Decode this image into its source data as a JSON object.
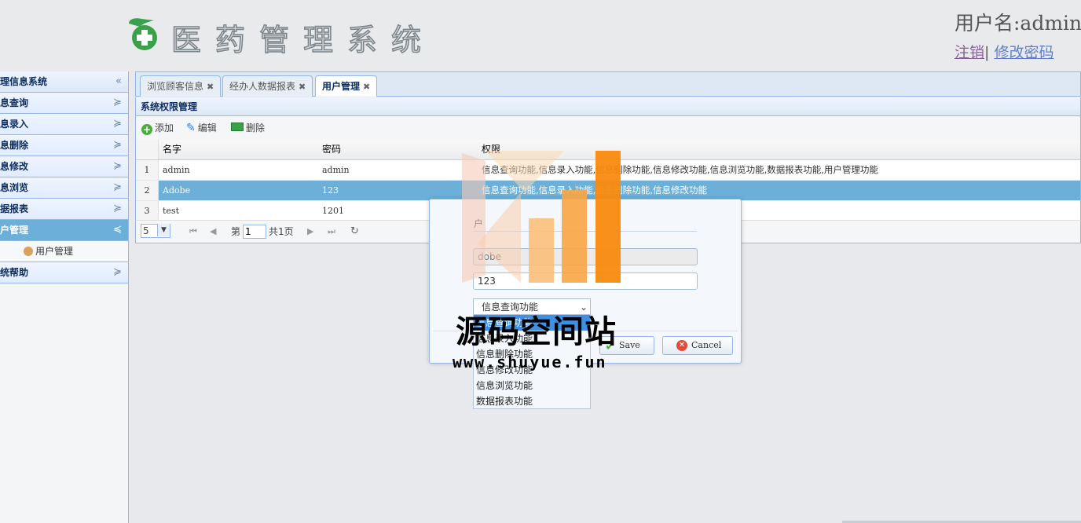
{
  "app": {
    "title": "医药管理系统",
    "user_label": "用户名:admin",
    "logout_link": "注销",
    "separator": "|",
    "change_password_link": "修改密码"
  },
  "sidebar": {
    "title": "管理信息系统",
    "collapse_glyph": "«",
    "items": [
      {
        "label": "信息查询"
      },
      {
        "label": "信息录入"
      },
      {
        "label": "信息删除"
      },
      {
        "label": "信息修改"
      },
      {
        "label": "信息浏览"
      },
      {
        "label": "数据报表"
      },
      {
        "label": "用户管理",
        "active": true
      },
      {
        "label": "系统帮助"
      }
    ],
    "sub_item": "用户管理"
  },
  "tabs": [
    {
      "label": "浏览顾客信息",
      "active": false
    },
    {
      "label": "经办人数据报表",
      "active": false
    },
    {
      "label": "用户管理",
      "active": true
    }
  ],
  "panel": {
    "title": "系统权限管理"
  },
  "toolbar": {
    "add_label": "添加",
    "edit_label": "编辑",
    "delete_label": "删除"
  },
  "grid": {
    "columns": [
      "名字",
      "密码",
      "权限"
    ],
    "rows": [
      {
        "num": "1",
        "name": "admin",
        "password": "admin",
        "permissions": "信息查询功能,信息录入功能,信息删除功能,信息修改功能,信息浏览功能,数据报表功能,用户管理功能"
      },
      {
        "num": "2",
        "name": "Adobe",
        "password": "123",
        "permissions": "信息查询功能,信息录入功能,信息删除功能,信息修改功能",
        "selected": true
      },
      {
        "num": "3",
        "name": "test",
        "password": "1201",
        "permissions": ""
      }
    ]
  },
  "pager": {
    "page_size": "5",
    "page_prefix": "第",
    "page_value": "1",
    "total_label": "共1页"
  },
  "dialog": {
    "heading": "户",
    "name_value": "dobe",
    "password_value": "123",
    "permission_selected": "信息查询功能",
    "save_label": "Save",
    "cancel_label": "Cancel"
  },
  "dropdown": {
    "options": [
      "信息查询功能",
      "信息录入功能",
      "信息删除功能",
      "信息修改功能",
      "信息浏览功能",
      "数据报表功能"
    ]
  },
  "watermark": {
    "text": "源码空间站",
    "url": "www.shuyue.fun"
  },
  "colors": {
    "accent": "#6cb0da",
    "border": "#95b8e7",
    "nav_text": "#0e2d5f",
    "watermark_orange": "#f98a0e"
  }
}
